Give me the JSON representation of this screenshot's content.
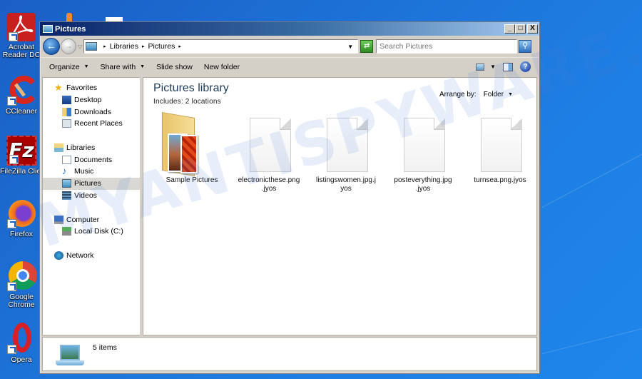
{
  "desktop": {
    "icons": [
      {
        "label": "Acrobat Reader DC",
        "icon": "acrobat-icon"
      },
      {
        "label": "CCleaner",
        "icon": "ccleaner-icon"
      },
      {
        "label": "FileZilla Client",
        "icon": "filezilla-icon"
      },
      {
        "label": "Firefox",
        "icon": "firefox-icon"
      },
      {
        "label": "Google Chrome",
        "icon": "chrome-icon"
      },
      {
        "label": "Opera",
        "icon": "opera-icon"
      }
    ],
    "watermark": "MYANTISPYWARE.COM"
  },
  "window": {
    "title": "Pictures",
    "buttons": {
      "minimize": "_",
      "maximize": "□",
      "close": "X"
    },
    "address": {
      "breadcrumb": [
        "Libraries",
        "Pictures"
      ],
      "separator": "▸"
    },
    "search": {
      "placeholder": "Search Pictures"
    },
    "toolbar": {
      "items": [
        {
          "label": "Organize",
          "dropdown": true
        },
        {
          "label": "Share with",
          "dropdown": true
        },
        {
          "label": "Slide show",
          "dropdown": false
        },
        {
          "label": "New folder",
          "dropdown": false
        }
      ],
      "help": "?"
    },
    "navpane": {
      "favorites": {
        "label": "Favorites",
        "children": [
          "Desktop",
          "Downloads",
          "Recent Places"
        ]
      },
      "libraries": {
        "label": "Libraries",
        "children": [
          "Documents",
          "Music",
          "Pictures",
          "Videos"
        ],
        "selected": "Pictures"
      },
      "computer": {
        "label": "Computer",
        "children": [
          "Local Disk (C:)"
        ]
      },
      "network": {
        "label": "Network"
      }
    },
    "library": {
      "title": "Pictures library",
      "includes": "Includes:  2 locations",
      "arrange_label": "Arrange by:",
      "arrange_value": "Folder"
    },
    "files": [
      {
        "name": "Sample Pictures",
        "type": "folder"
      },
      {
        "name": "electronicthese.png.jyos",
        "line1": "electronicthese.png",
        "line2": ".jyos",
        "type": "file"
      },
      {
        "name": "listingswomen.jpg.jyos",
        "line1": "listingswomen.jpg.j",
        "line2": "yos",
        "type": "file"
      },
      {
        "name": "posteverything.jpg.jyos",
        "line1": "posteverything.jpg",
        "line2": ".jyos",
        "type": "file"
      },
      {
        "name": "turnsea.png.jyos",
        "line1": "turnsea.png.jyos",
        "line2": "",
        "type": "file"
      }
    ],
    "status": {
      "count": "5 items"
    }
  }
}
